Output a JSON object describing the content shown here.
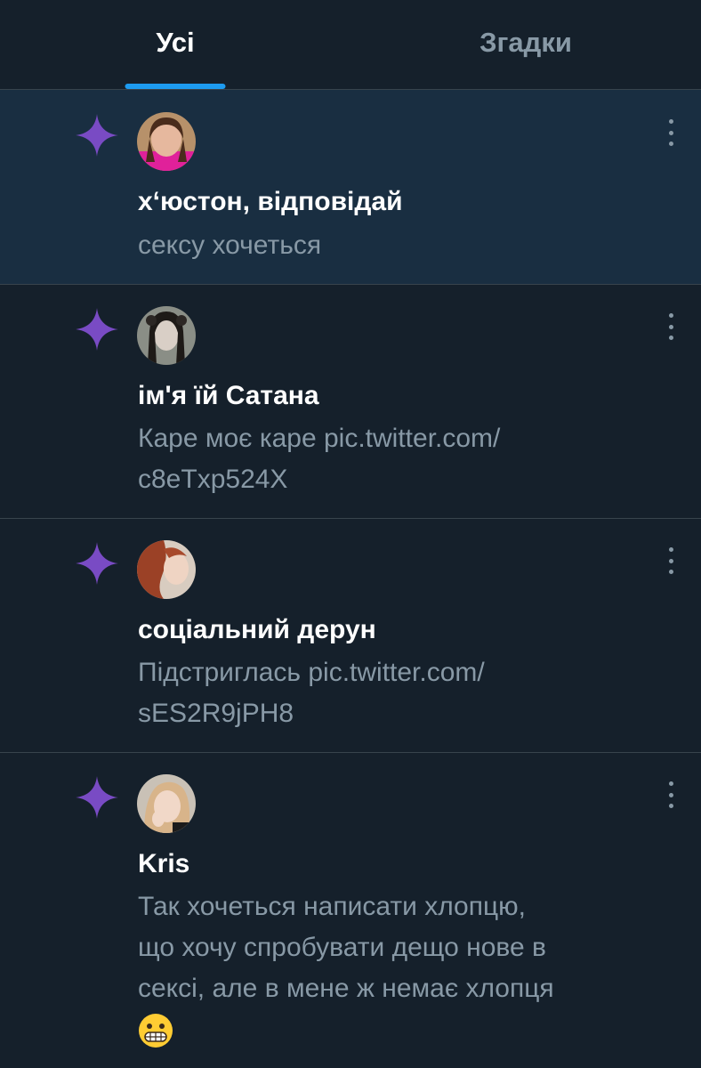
{
  "tabs": [
    {
      "label": "Усі",
      "active": true
    },
    {
      "label": "Згадки",
      "active": false
    }
  ],
  "colors": {
    "background": "#15202b",
    "highlight": "#192e41",
    "accent": "#1d9bf0",
    "sparkle": "#794bc4",
    "secondary_text": "#8899a6"
  },
  "notifications": [
    {
      "icon": "sparkle-icon",
      "name": "х‘юстон, відповідай",
      "text": "сексу хочеться",
      "highlighted": true
    },
    {
      "icon": "sparkle-icon",
      "name": "ім'я їй Сатана",
      "text_line1": "Каре моє каре pic.twitter.com/",
      "text_line2": "c8eTxp524X",
      "highlighted": false
    },
    {
      "icon": "sparkle-icon",
      "name": "соціальний дерун",
      "text_line1": "Підстриглась pic.twitter.com/",
      "text_line2": "sES2R9jPH8",
      "highlighted": false
    },
    {
      "icon": "sparkle-icon",
      "name": "Kris",
      "text_line1": "Так хочеться написати хлопцю,",
      "text_line2": "що хочу спробувати дещо нове в",
      "text_line3": "сексі, але в мене ж немає хлопця",
      "emoji": "grimacing-face-emoji",
      "highlighted": false
    }
  ]
}
